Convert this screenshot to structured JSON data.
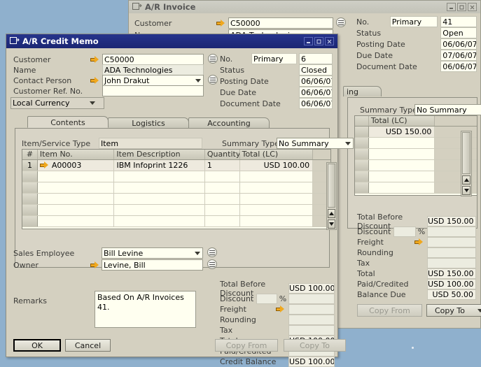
{
  "desktop": {
    "bg": "#8fb0cd"
  },
  "invoice_window": {
    "title": "A/R Invoice",
    "icon": "document-icon",
    "buttons": {
      "minimize": "_",
      "maximize": "□",
      "close": "×"
    },
    "fields": {
      "customer_label": "Customer",
      "customer_value": "C50000",
      "name_label": "Name",
      "name_value": "ADA Technologies"
    },
    "info": [
      {
        "label": "No.",
        "sub": "Primary",
        "value": "41"
      },
      {
        "label": "Status",
        "sub": "",
        "value": "Open"
      },
      {
        "label": "Posting Date",
        "sub": "",
        "value": "06/06/07"
      },
      {
        "label": "Due Date",
        "sub": "",
        "value": "07/06/07"
      },
      {
        "label": "Document Date",
        "sub": "",
        "value": "06/06/07"
      }
    ],
    "tab_partial": "ing",
    "summary_type_label": "Summary Type",
    "summary_type_value": "No Summary",
    "grid_header": "Total (LC)",
    "grid_value": "USD 150.00",
    "totals": [
      {
        "label": "Total Before Discount",
        "value": "USD 150.00"
      },
      {
        "label": "Discount",
        "value": "",
        "pct": "%"
      },
      {
        "label": "Freight",
        "value": "",
        "arrow": true
      },
      {
        "label": "Rounding",
        "value": ""
      },
      {
        "label": "Tax",
        "value": ""
      },
      {
        "label": "Total",
        "value": "USD 150.00"
      },
      {
        "label": "Paid/Credited",
        "value": "USD 100.00"
      },
      {
        "label": "Balance Due",
        "value": "USD 50.00"
      }
    ],
    "copy_from": "Copy From",
    "copy_to": "Copy To"
  },
  "memo_window": {
    "title": "A/R Credit Memo",
    "icon": "document-icon",
    "buttons": {
      "minimize": "_",
      "maximize": "□",
      "close": "×"
    },
    "left_fields": [
      {
        "label": "Customer",
        "value": "C50000",
        "arrow": true,
        "link": true
      },
      {
        "label": "Name",
        "value": "ADA Technologies",
        "arrow": false,
        "link": false
      },
      {
        "label": "Contact Person",
        "value": "John Drakut",
        "arrow": true,
        "link": true,
        "dropdown": true
      },
      {
        "label": "Customer Ref. No.",
        "value": "",
        "arrow": false,
        "link": false
      }
    ],
    "currency_value": "Local Currency",
    "info": [
      {
        "label": "No.",
        "sub": "Primary",
        "value": "6"
      },
      {
        "label": "Status",
        "sub": "",
        "value": "Closed"
      },
      {
        "label": "Posting Date",
        "sub": "",
        "value": "06/06/07"
      },
      {
        "label": "Due Date",
        "sub": "",
        "value": "06/06/07"
      },
      {
        "label": "Document Date",
        "sub": "",
        "value": "06/06/07"
      }
    ],
    "tabs": [
      {
        "label": "Contents",
        "selected": true
      },
      {
        "label": "Logistics",
        "selected": false
      },
      {
        "label": "Accounting",
        "selected": false
      }
    ],
    "item_service_type_label": "Item/Service Type",
    "item_service_type_value": "Item",
    "summary_type_label": "Summary Type",
    "summary_type_value": "No Summary",
    "grid": {
      "columns": [
        "#",
        "Item No.",
        "Item Description",
        "Quantity",
        "Total (LC)"
      ],
      "rows": [
        {
          "num": "1",
          "item_no": "A00003",
          "description": "IBM Infoprint 1226",
          "quantity": "1",
          "total": "USD 100.00"
        },
        {
          "num": "",
          "item_no": "",
          "description": "",
          "quantity": "",
          "total": ""
        },
        {
          "num": "",
          "item_no": "",
          "description": "",
          "quantity": "",
          "total": ""
        },
        {
          "num": "",
          "item_no": "",
          "description": "",
          "quantity": "",
          "total": ""
        },
        {
          "num": "",
          "item_no": "",
          "description": "",
          "quantity": "",
          "total": ""
        },
        {
          "num": "",
          "item_no": "",
          "description": "",
          "quantity": "",
          "total": ""
        }
      ]
    },
    "sales_employee_label": "Sales Employee",
    "sales_employee_value": "Bill Levine",
    "owner_label": "Owner",
    "owner_value": "Levine, Bill",
    "remarks_label": "Remarks",
    "remarks_value": "Based On A/R Invoices 41.",
    "totals": [
      {
        "label": "Total Before Discount",
        "value": "USD 100.00"
      },
      {
        "label": "Discount",
        "value": "",
        "pct": "%"
      },
      {
        "label": "Freight",
        "value": "",
        "arrow": true
      },
      {
        "label": "Rounding",
        "value": ""
      },
      {
        "label": "Tax",
        "value": ""
      },
      {
        "label": "Total",
        "value": "USD 100.00"
      },
      {
        "label": "Paid/Credited",
        "value": ""
      },
      {
        "label": "Credit Balance",
        "value": "USD 100.00"
      }
    ],
    "ok_label": "OK",
    "cancel_label": "Cancel",
    "copy_from": "Copy From",
    "copy_to": "Copy To"
  }
}
